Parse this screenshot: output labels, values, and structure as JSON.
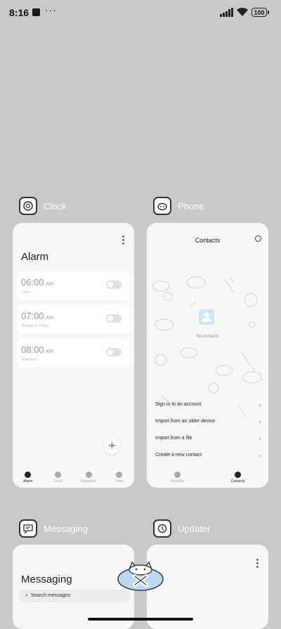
{
  "status_bar": {
    "time": "8:16",
    "more": "···",
    "battery": "100"
  },
  "recents": [
    {
      "app_name": "Clock",
      "screen": {
        "title": "Alarm",
        "alarms": [
          {
            "time": "06:00",
            "ampm": "AM",
            "detail": "Once",
            "enabled": false
          },
          {
            "time": "07:00",
            "ampm": "AM",
            "detail": "Monday to Friday",
            "enabled": false
          },
          {
            "time": "08:00",
            "ampm": "AM",
            "detail": "Weekend",
            "enabled": false
          }
        ],
        "nav": [
          "Alarm",
          "Clock",
          "Stopwatch",
          "Timer"
        ],
        "active_nav": "Alarm"
      }
    },
    {
      "app_name": "Phone",
      "screen": {
        "title": "Contacts",
        "empty_text": "No contacts",
        "options": [
          "Sign in to an account",
          "Import from an older device",
          "Import from a file",
          "Create a new contact"
        ],
        "nav": [
          "Recents",
          "Contacts"
        ],
        "active_nav": "Contacts"
      }
    },
    {
      "app_name": "Messaging",
      "screen": {
        "title": "Messaging",
        "search_placeholder": "Search messages"
      }
    },
    {
      "app_name": "Updater"
    }
  ],
  "icons": {
    "accent": "#2b83f6"
  }
}
